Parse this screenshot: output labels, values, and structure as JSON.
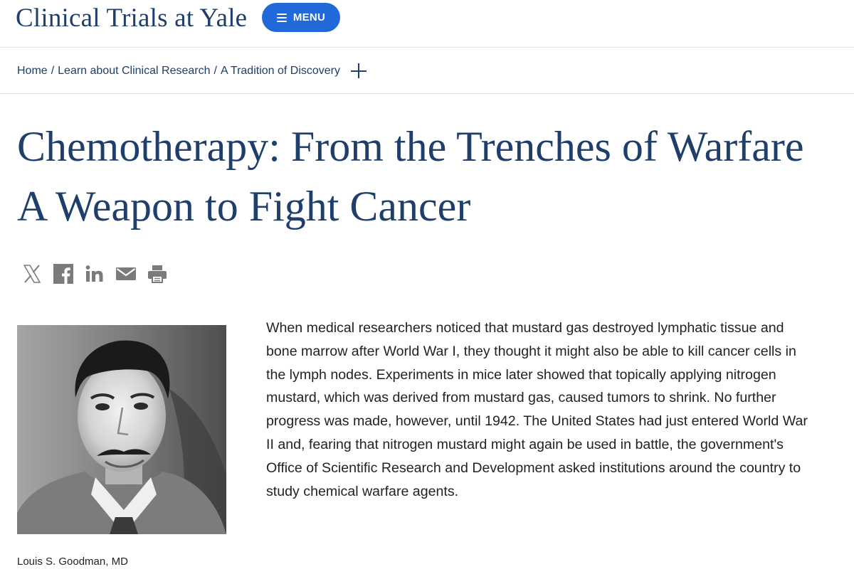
{
  "header": {
    "site_title": "Clinical Trials at Yale",
    "menu_label": "MENU"
  },
  "breadcrumb": {
    "items": [
      "Home",
      "Learn about Clinical Research",
      "A Tradition of Discovery"
    ],
    "separator": "/"
  },
  "article": {
    "title": "Chemotherapy: From the Trenches of Warfare A Weapon to Fight Cancer",
    "share_icons": [
      "x-icon",
      "facebook-icon",
      "linkedin-icon",
      "email-icon",
      "print-icon"
    ],
    "image_caption": "Louis S. Goodman, MD",
    "body": "When medical researchers noticed that mustard gas destroyed lymphatic tissue and bone marrow after World War I, they thought it might also be able to kill cancer cells in the lymph nodes. Experiments in mice later showed that topically applying nitrogen mustard, which was derived from mustard gas, caused tumors to shrink. No further progress was made, however, until 1942. The United States had just entered World War II and, fearing that nitrogen mustard might again be used in battle, the government's Office of Scientific Research and Development asked institutions around the country to study chemical warfare agents."
  },
  "colors": {
    "brand_navy": "#1e3e6b",
    "menu_blue": "#2169d8",
    "icon_gray": "#7b7b7b"
  }
}
